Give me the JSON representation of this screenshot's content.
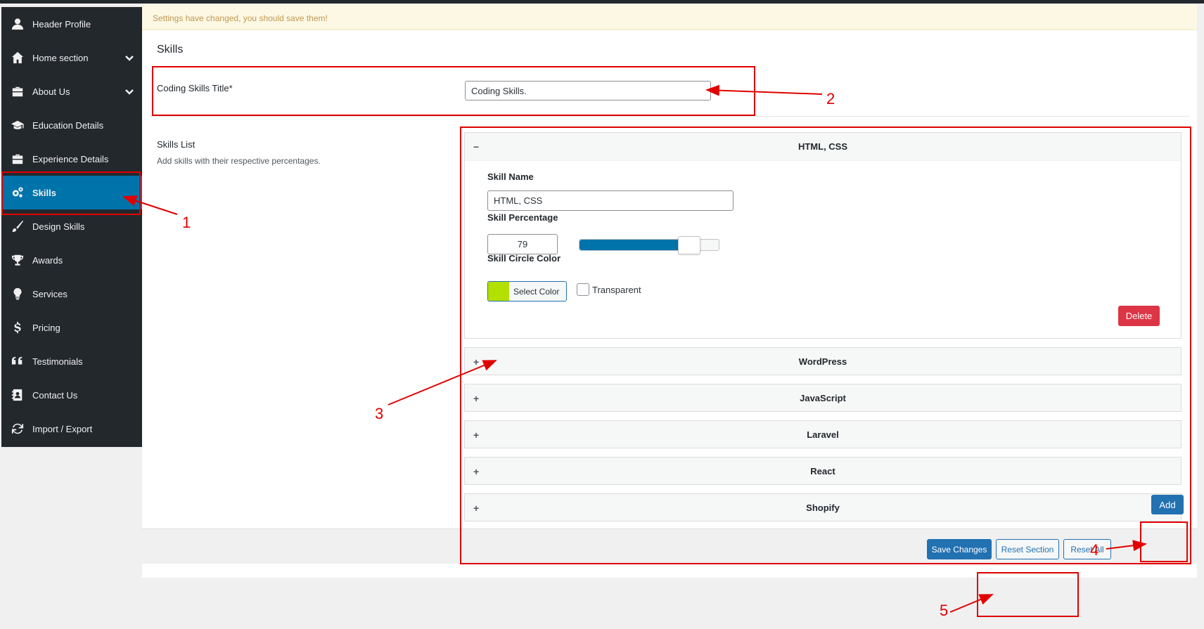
{
  "sidebar": {
    "items": [
      {
        "label": "Header Profile",
        "icon": "user-icon"
      },
      {
        "label": "Home section",
        "icon": "home-icon",
        "has_children": true
      },
      {
        "label": "About Us",
        "icon": "briefcase-icon",
        "has_children": true
      },
      {
        "label": "Education Details",
        "icon": "graduation-cap-icon"
      },
      {
        "label": "Experience Details",
        "icon": "briefcase-icon"
      },
      {
        "label": "Skills",
        "icon": "gears-icon",
        "active": true
      },
      {
        "label": "Design Skills",
        "icon": "brush-icon"
      },
      {
        "label": "Awards",
        "icon": "trophy-icon"
      },
      {
        "label": "Services",
        "icon": "lightbulb-icon"
      },
      {
        "label": "Pricing",
        "icon": "dollar-icon"
      },
      {
        "label": "Testimonials",
        "icon": "quote-icon"
      },
      {
        "label": "Contact Us",
        "icon": "address-card-icon"
      },
      {
        "label": "Import / Export",
        "icon": "refresh-icon"
      }
    ]
  },
  "notice": "Settings have changed, you should save them!",
  "section": {
    "title": "Skills",
    "coding_title_label": "Coding Skills Title*",
    "coding_title_value": "Coding Skills.",
    "skills_list_label": "Skills List",
    "skills_list_desc": "Add skills with their respective percentages."
  },
  "skills": {
    "open": {
      "title": "HTML, CSS",
      "toggle": "−",
      "name_label": "Skill Name",
      "name_value": "HTML, CSS",
      "percentage_label": "Skill Percentage",
      "percentage_value": "79",
      "percentage": 79,
      "color_label": "Skill Circle Color",
      "color": "#b4e000",
      "select_color_label": "Select Color",
      "transparent_label": "Transparent",
      "delete_label": "Delete"
    },
    "collapsed": [
      {
        "title": "WordPress",
        "toggle": "+"
      },
      {
        "title": "JavaScript",
        "toggle": "+"
      },
      {
        "title": "Laravel",
        "toggle": "+"
      },
      {
        "title": "React",
        "toggle": "+"
      },
      {
        "title": "Shopify",
        "toggle": "+"
      }
    ],
    "add_label": "Add"
  },
  "footer": {
    "save_label": "Save Changes",
    "reset_section_label": "Reset Section",
    "reset_all_label": "Reset All"
  },
  "annotations": [
    "1",
    "2",
    "3",
    "4",
    "5"
  ],
  "colors": {
    "sidebar_bg": "#23282d",
    "active_bg": "#0073aa",
    "primary": "#2271b1",
    "danger": "#dc3545",
    "annotation": "#e00000"
  }
}
